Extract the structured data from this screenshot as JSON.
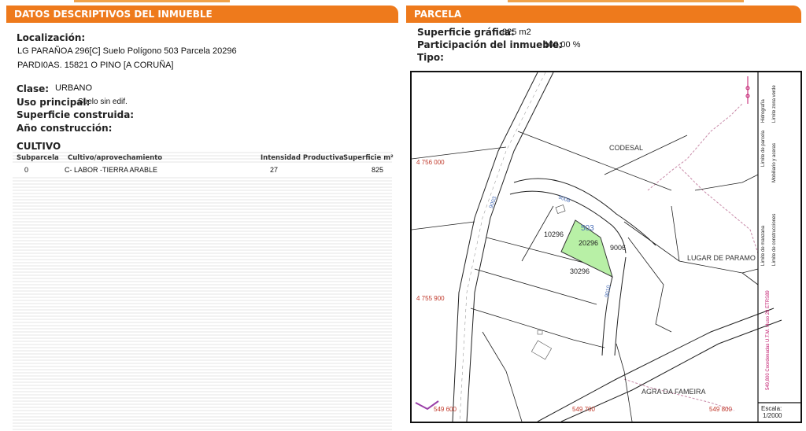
{
  "left": {
    "header": "DATOS DESCRIPTIVOS DEL INMUEBLE",
    "localizacion_label": "Localización:",
    "localizacion_line1": "LG PARAÑOA 296[C] Suelo Polígono 503 Parcela 20296",
    "localizacion_line2": "PARDI0AS. 15821 O PINO [A CORUÑA]",
    "clase_label": "Clase:",
    "clase_value": "URBANO",
    "uso_label": "Uso principal:",
    "uso_value": "Suelo sin edif.",
    "superficie_construida_label": "Superficie construida:",
    "ano_label": "Año construcción:",
    "cultivo_title": "CULTIVO",
    "table": {
      "headers": [
        "Subparcela",
        "Cultivo/aprovechamiento",
        "Intensidad Productiva",
        "Superficie m²"
      ],
      "rows": [
        {
          "subparcela": "0",
          "cultivo": "C- LABOR -TIERRA ARABLE",
          "intensidad": "27",
          "superficie": "825"
        }
      ]
    }
  },
  "right": {
    "header": "PARCELA",
    "superficie_grafica_label": "Superficie gráfica:",
    "superficie_grafica_value": "825 m2",
    "participacion_label": "Participación del inmueble:",
    "participacion_value": "100,00 %",
    "tipo_label": "Tipo:"
  },
  "map": {
    "place_codesal": "CODESAL",
    "place_lugar": "LUGAR DE PARAMO",
    "place_agra": "AGRA DA FAMEIRA",
    "parcel_main": "20296",
    "parcel_10296": "10296",
    "parcel_30296": "30296",
    "parcel_9006": "9006",
    "polygon_503": "503",
    "road_9003": "9003",
    "road_9008": "9008",
    "road_9010": "9010",
    "coord_y1": "4 756 000",
    "coord_y2": "4 755 900",
    "coord_x1": "549 600",
    "coord_x2": "549 700",
    "coord_x3": "549 800",
    "legend": {
      "parcela": "Límite de parcela",
      "hidrografia": "Hidrografía",
      "zona_verde": "Límite zona verde",
      "mobiliario": "Mobiliario y aceras",
      "manzana": "Límite de manzana",
      "construcciones": "Límite de construcciones",
      "coords": "549,800 Coordenadas U.T.M. Huso 29 ETRS89"
    },
    "scale_label": "Escala:",
    "scale_value": "1/2000",
    "colors": {
      "parcel_fill": "#b8f0a6",
      "legend_accent": "#c0146a",
      "boundary": "#c88aa8"
    }
  }
}
